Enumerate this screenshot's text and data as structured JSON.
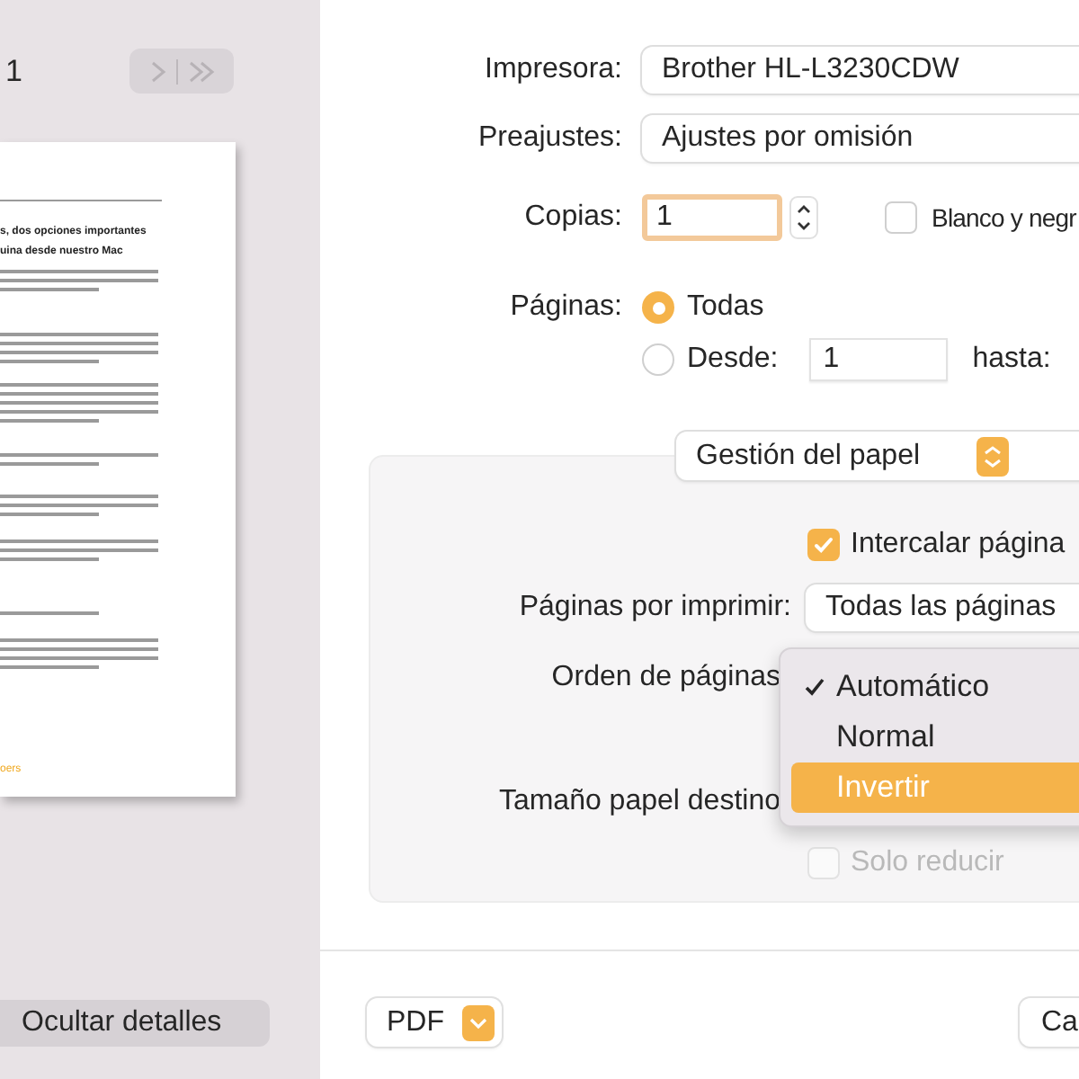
{
  "preview": {
    "page_number": "1",
    "headline": [
      "s, dos opciones importantes",
      "uina desde nuestro Mac"
    ],
    "footer_text": "oers"
  },
  "hide_details_button": "Ocultar detalles",
  "form": {
    "printer": {
      "label": "Impresora:",
      "value": "Brother HL-L3230CDW"
    },
    "presets": {
      "label": "Preajustes:",
      "value": "Ajustes por omisión"
    },
    "copies": {
      "label": "Copias:",
      "value": "1",
      "focused": true
    },
    "black_white": {
      "label": "Blanco y negr",
      "checked": false
    },
    "pages": {
      "label": "Páginas:",
      "options": [
        {
          "label": "Todas",
          "selected": true
        },
        {
          "label": "Desde:",
          "selected": false
        }
      ],
      "from": "1",
      "to_label": "hasta:"
    }
  },
  "section_popup": "Gestión del papel",
  "paper_handling": {
    "collate": {
      "label": "Intercalar página",
      "checked": true
    },
    "pages_to_print": {
      "label": "Páginas por imprimir:",
      "value": "Todas las páginas"
    },
    "page_order": {
      "label": "Orden de páginas"
    },
    "paper_size": {
      "label": "Tamaño papel destino"
    },
    "scale_down": {
      "label": "Solo reducir",
      "checked": false,
      "disabled": true
    }
  },
  "menu": [
    {
      "label": "Automático",
      "checked": true,
      "selected": false
    },
    {
      "label": "Normal",
      "checked": false,
      "selected": false
    },
    {
      "label": "Invertir",
      "checked": false,
      "selected": true
    }
  ],
  "footer": {
    "pdf": "PDF",
    "cancel": "Ca"
  }
}
